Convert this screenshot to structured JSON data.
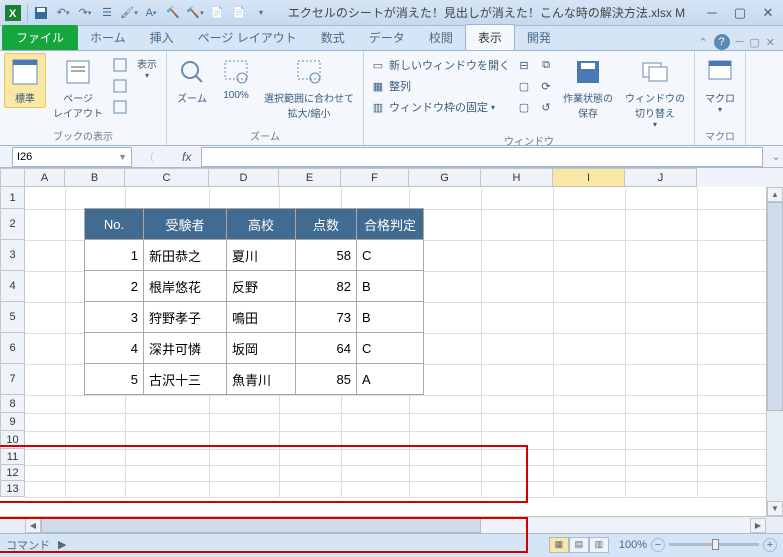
{
  "title": "エクセルのシートが消えた！見出しが消えた！こんな時の解決方法.xlsx M",
  "tabs": {
    "file": "ファイル",
    "items": [
      "ホーム",
      "挿入",
      "ページ レイアウト",
      "数式",
      "データ",
      "校閲",
      "表示",
      "開発"
    ],
    "active": "表示"
  },
  "ribbon": {
    "group1_label": "ブックの表示",
    "btn_normal": "標準",
    "btn_pagelayout": "ページ\nレイアウト",
    "btn_display": "表示",
    "group2_label": "ズーム",
    "btn_zoom": "ズーム",
    "btn_100": "100%",
    "btn_zoomselect": "選択範囲に合わせて\n拡大/縮小",
    "group3_label": "ウィンドウ",
    "btn_newwin": "新しいウィンドウを開く",
    "btn_arrange": "整列",
    "btn_freeze": "ウィンドウ枠の固定",
    "btn_savews": "作業状態の\n保存",
    "btn_switchwin": "ウィンドウの\n切り替え",
    "group4_label": "マクロ",
    "btn_macro": "マクロ"
  },
  "namebox": "I26",
  "columns": [
    "A",
    "B",
    "C",
    "D",
    "E",
    "F",
    "G",
    "H",
    "I",
    "J"
  ],
  "active_col": "I",
  "rows": [
    1,
    2,
    3,
    4,
    5,
    6,
    7,
    8,
    9,
    10,
    11,
    12,
    13
  ],
  "table": {
    "headers": {
      "no": "No.",
      "name": "受験者",
      "school": "高校",
      "score": "点数",
      "result": "合格判定"
    },
    "data": [
      {
        "no": "1",
        "name": "新田恭之",
        "school": "夏川",
        "score": "58",
        "result": "C"
      },
      {
        "no": "2",
        "name": "根岸悠花",
        "school": "反野",
        "score": "82",
        "result": "B"
      },
      {
        "no": "3",
        "name": "狩野孝子",
        "school": "鳴田",
        "score": "73",
        "result": "B"
      },
      {
        "no": "4",
        "name": "深井可憐",
        "school": "坂岡",
        "score": "64",
        "result": "C"
      },
      {
        "no": "5",
        "name": "古沢十三",
        "school": "魚青川",
        "score": "85",
        "result": "A"
      }
    ]
  },
  "status": {
    "left": "コマンド",
    "zoom": "100%"
  }
}
